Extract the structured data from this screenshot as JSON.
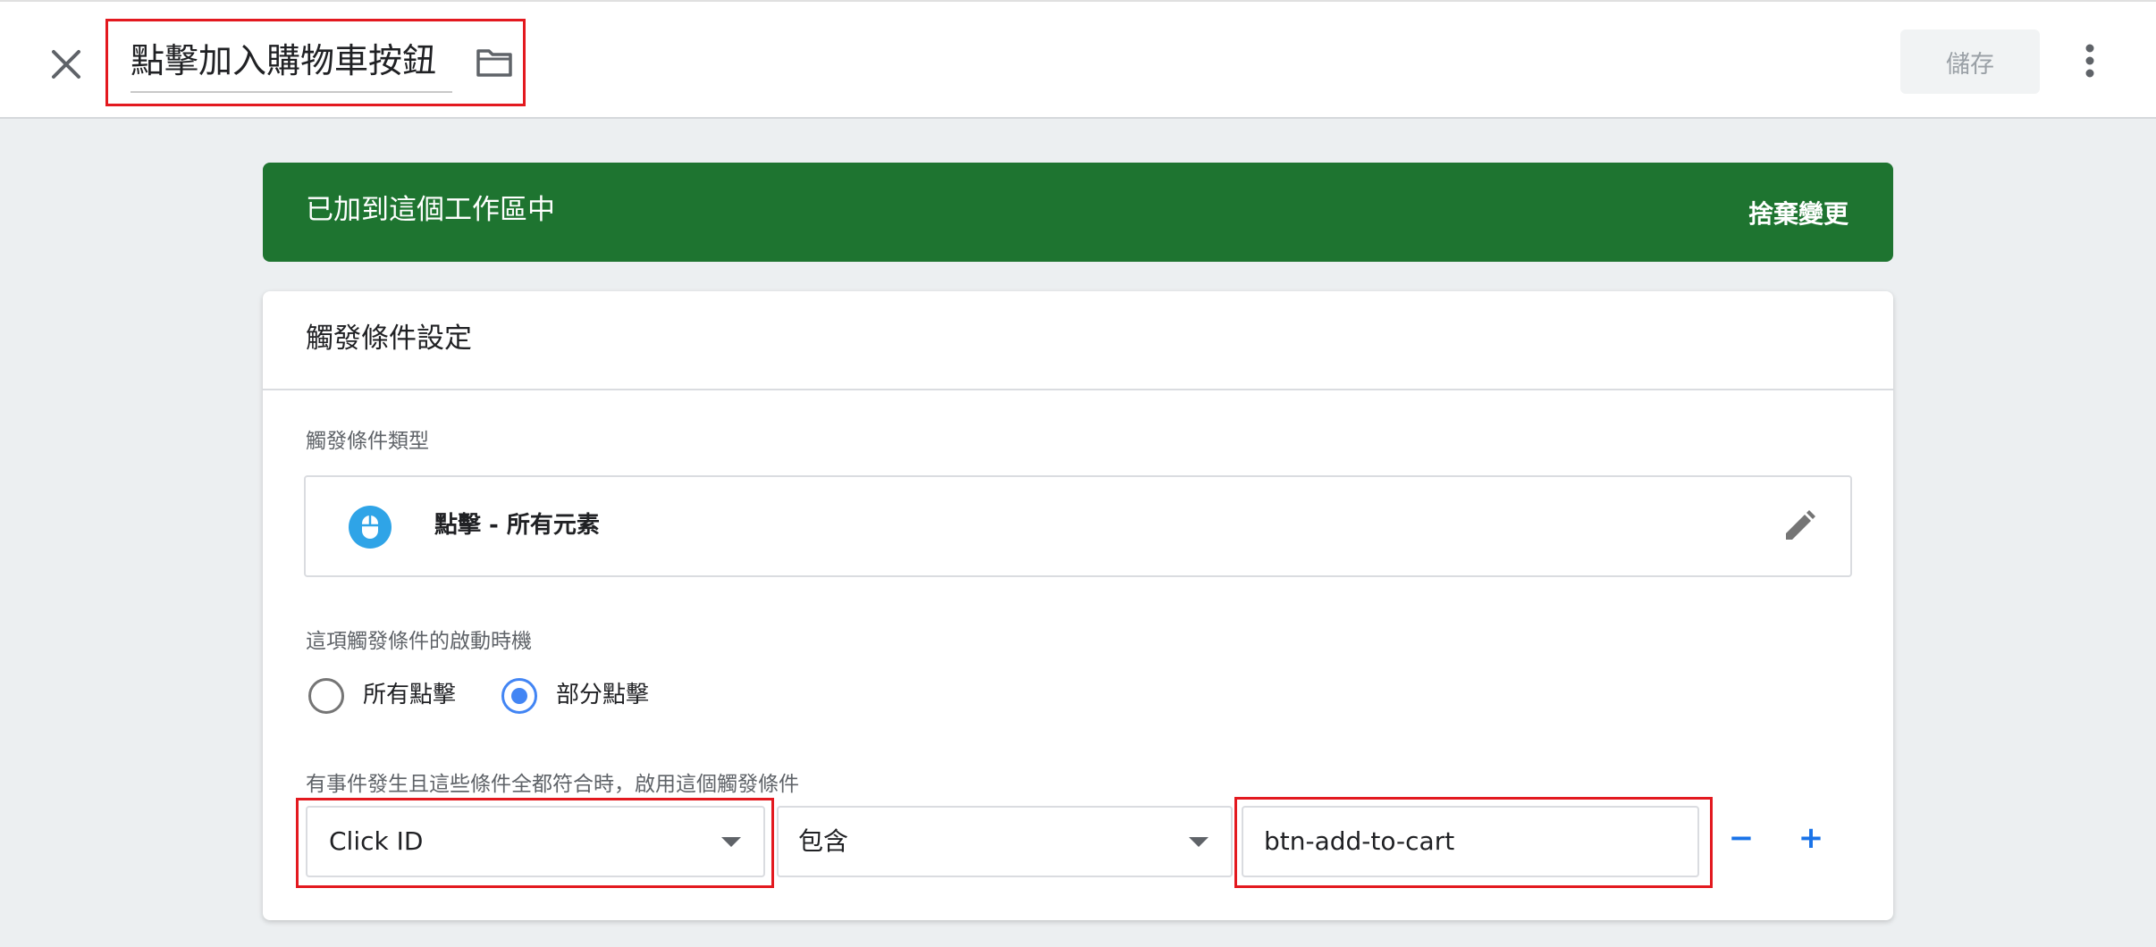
{
  "header": {
    "title": "點擊加入購物車按鈕",
    "save_label": "儲存"
  },
  "banner": {
    "message": "已加到這個工作區中",
    "discard_label": "捨棄變更"
  },
  "trigger": {
    "section_title": "觸發條件設定",
    "type_label": "觸發條件類型",
    "type_value": "點擊 - 所有元素",
    "fires_on_label": "這項觸發條件的啟動時機",
    "options": [
      {
        "label": "所有點擊",
        "selected": false
      },
      {
        "label": "部分點擊",
        "selected": true
      }
    ],
    "condition_label": "有事件發生且這些條件全都符合時，啟用這個觸發條件",
    "condition": {
      "variable": "Click ID",
      "operator": "包含",
      "value": "btn-add-to-cart"
    },
    "remove_label": "−",
    "add_label": "+"
  },
  "colors": {
    "banner_green": "#1e7430",
    "highlight_red": "#e3191f",
    "accent_blue": "#4285f4",
    "link_blue": "#1a73e8"
  },
  "icons": [
    "close-icon",
    "folder-icon",
    "more-vert-icon",
    "mouse-icon",
    "pencil-icon",
    "dropdown-caret-icon"
  ]
}
